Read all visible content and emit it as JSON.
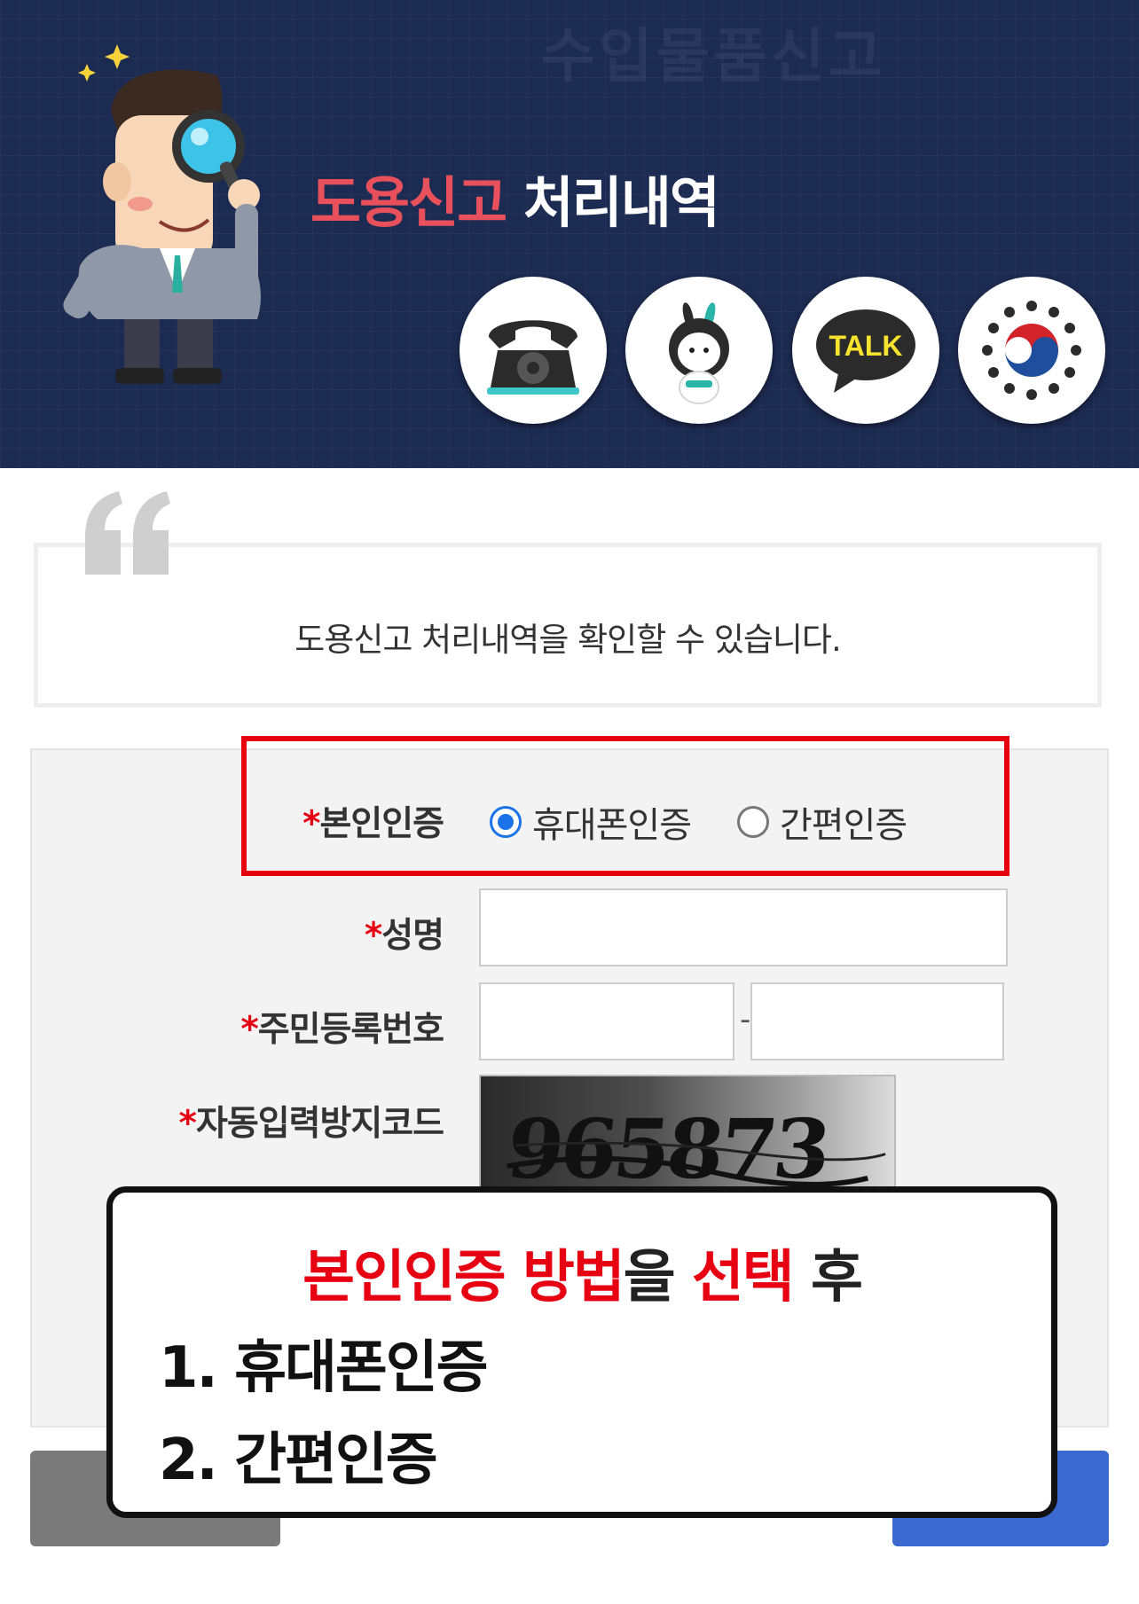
{
  "banner": {
    "watermark": "수입물품신고",
    "title_highlight": "도용신고",
    "title_rest": " 처리내역"
  },
  "shortcuts": [
    {
      "icon": "telephone-icon"
    },
    {
      "icon": "rabbit-mascot-icon"
    },
    {
      "icon": "kakao-talk-icon",
      "text": "TALK"
    },
    {
      "icon": "government-emblem-icon"
    }
  ],
  "intro": {
    "text": "도용신고 처리내역을 확인할 수 있습니다."
  },
  "form": {
    "auth_label": "본인인증",
    "auth_options": [
      {
        "label": "휴대폰인증",
        "checked": true
      },
      {
        "label": "간편인증",
        "checked": false
      }
    ],
    "name_label": "성명",
    "name_value": "",
    "rrn_label": "주민등록번호",
    "rrn_front_value": "",
    "rrn_back_value": "",
    "rrn_separator": "-",
    "captcha_label": "자동입력방지코드",
    "captcha_code": "965873",
    "required_mark": "*"
  },
  "caption": {
    "head_red_1": "본인인증 방법",
    "head_black_1": "을 ",
    "head_red_2": "선택",
    "head_black_2": " 후",
    "line1": "1. 휴대폰인증",
    "line2": "2. 간편인증"
  },
  "colors": {
    "banner_bg": "#1c2b52",
    "title_highlight": "#e8505b",
    "required": "#e60012",
    "radio_checked": "#1a73e8",
    "button_right": "#3a69cf",
    "button_left": "#7a7a7a"
  }
}
